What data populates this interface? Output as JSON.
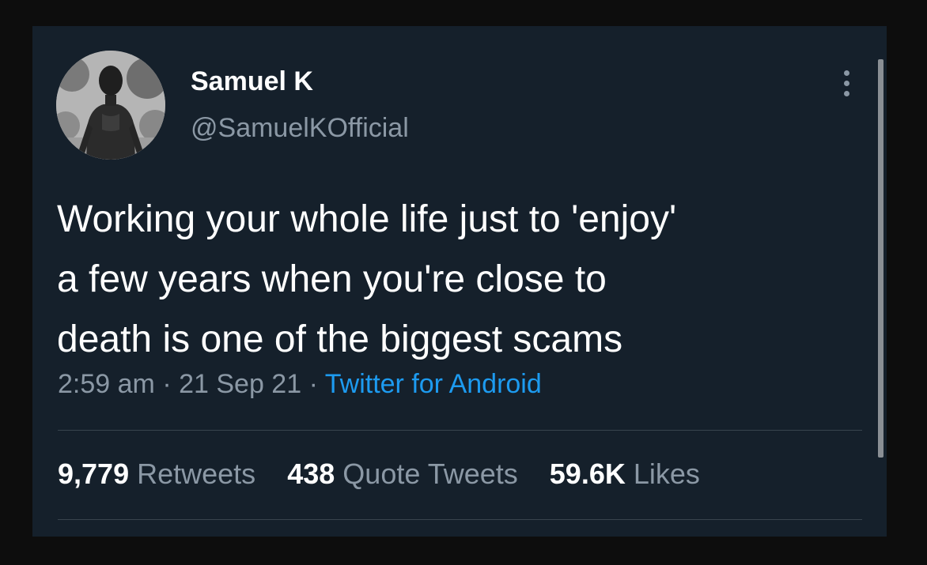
{
  "tweet": {
    "author": {
      "display_name": "Samuel K",
      "handle": "@SamuelKOfficial",
      "avatar_icon": "profile-photo"
    },
    "more_icon": "vertical-ellipsis-icon",
    "text_lines": [
      "Working your whole life just to 'enjoy'",
      "a few years when you're close to",
      "death is one of the biggest scams"
    ],
    "time": "2:59 am",
    "separator": "·",
    "date": "21 Sep 21",
    "source": "Twitter for Android",
    "stats": {
      "retweets": {
        "count": "9,779",
        "label": "Retweets"
      },
      "quotes": {
        "count": "438",
        "label": "Quote Tweets"
      },
      "likes": {
        "count": "59.6K",
        "label": "Likes"
      }
    }
  },
  "colors": {
    "background": "#0d0d0d",
    "card": "#15202b",
    "primary_text": "#ffffff",
    "secondary_text": "#8b98a5",
    "link": "#1d9bf0",
    "divider": "#38444d"
  }
}
